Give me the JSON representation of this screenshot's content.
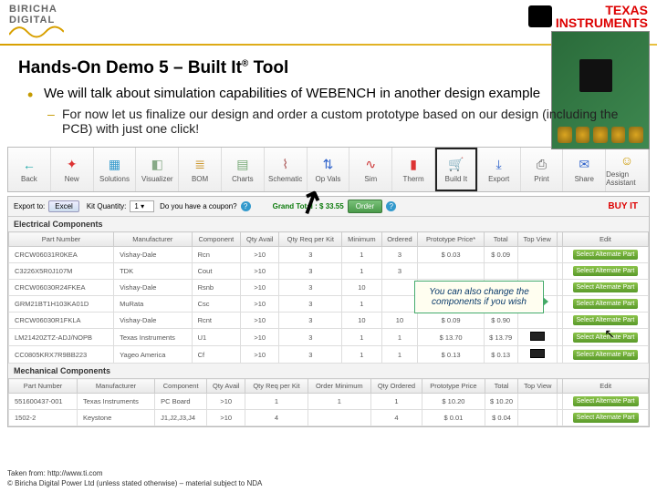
{
  "logos": {
    "biricha1": "BIRICHA",
    "biricha2": "DIGITAL",
    "ti1": "TEXAS",
    "ti2": "INSTRUMENTS"
  },
  "title_pre": "Hands-On Demo 5 – Built It",
  "title_post": " Tool",
  "reg": "®",
  "bullet1": "We will talk about simulation capabilities of WEBENCH in another design example",
  "bullet2": "For now let us finalize our design and order a custom prototype based on our design (including the PCB) with just one click!",
  "toolbar": [
    {
      "label": "Back",
      "glyph": "←",
      "c": "#2aa"
    },
    {
      "label": "New",
      "glyph": "✦",
      "c": "#d33"
    },
    {
      "label": "Solutions",
      "glyph": "▦",
      "c": "#39c"
    },
    {
      "label": "Visualizer",
      "glyph": "◧",
      "c": "#8a8"
    },
    {
      "label": "BOM",
      "glyph": "≣",
      "c": "#c93"
    },
    {
      "label": "Charts",
      "glyph": "▤",
      "c": "#7a7"
    },
    {
      "label": "Schematic",
      "glyph": "⌇",
      "c": "#a55"
    },
    {
      "label": "Op Vals",
      "glyph": "⇅",
      "c": "#36c"
    },
    {
      "label": "Sim",
      "glyph": "∿",
      "c": "#c33"
    },
    {
      "label": "Therm",
      "glyph": "▮",
      "c": "#d33"
    },
    {
      "label": "Build It",
      "glyph": "🛒",
      "c": "#3a3",
      "hl": true
    },
    {
      "label": "Export",
      "glyph": "⤓",
      "c": "#36c"
    },
    {
      "label": "Print",
      "glyph": "⎙",
      "c": "#555"
    },
    {
      "label": "Share",
      "glyph": "✉",
      "c": "#36c"
    },
    {
      "label": "Design Assistant",
      "glyph": "☺",
      "c": "#c90"
    }
  ],
  "panel": {
    "export_to": "Export to:",
    "excel": "Excel",
    "kit_qty_lbl": "Kit Quantity:",
    "kit_qty_val": "1 ▾",
    "coupon": "Do you have a coupon?",
    "grand_lbl": "Grand Total :",
    "grand_val": "$ 33.55",
    "order": "Order",
    "buy": "BUY IT"
  },
  "sect_elec": "Electrical Components",
  "elec_headers": [
    "Part Number",
    "Manufacturer",
    "Component",
    "Qty Avail",
    "Qty Req per Kit",
    "Minimum",
    "Ordered",
    "Prototype Price*",
    "Total",
    "Top View",
    "",
    "Edit"
  ],
  "elec_rows": [
    [
      "CRCW06031R0KEA",
      "Vishay-Dale",
      "Rcn",
      ">10",
      "3",
      "1",
      "3",
      "$ 0.03",
      "$ 0.09",
      "",
      ""
    ],
    [
      "C3226X5R0J107M",
      "TDK",
      "Cout",
      ">10",
      "3",
      "1",
      "3",
      "",
      "",
      "",
      ""
    ],
    [
      "CRCW06030R24FKEA",
      "Vishay-Dale",
      "Rsnb",
      ">10",
      "3",
      "10",
      "",
      "",
      "",
      "",
      ""
    ],
    [
      "GRM21BT1H103KA01D",
      "MuRata",
      "Csc",
      ">10",
      "3",
      "1",
      "",
      "",
      "",
      "",
      ""
    ],
    [
      "CRCW06030R1FKLA",
      "Vishay-Dale",
      "Rcnt",
      ">10",
      "3",
      "10",
      "10",
      "$ 0.09",
      "$ 0.90",
      "",
      ""
    ],
    [
      "LM21420ZTZ-ADJ/NOPB",
      "Texas Instruments",
      "U1",
      ">10",
      "3",
      "1",
      "1",
      "$ 13.70",
      "$ 13.79",
      "chip",
      ""
    ],
    [
      "CC0805KRX7R9BB223",
      "Yageo America",
      "Cf",
      ">10",
      "3",
      "1",
      "1",
      "$ 0.13",
      "$ 0.13",
      "chip",
      ""
    ]
  ],
  "sect_mech": "Mechanical Components",
  "mech_headers": [
    "Part Number",
    "Manufacturer",
    "Component",
    "Qty Avail",
    "Qty Req per Kit",
    "Order Minimum",
    "Qty Ordered",
    "Prototype Price",
    "Total",
    "Top View",
    "",
    "Edit"
  ],
  "mech_rows": [
    [
      "551600437-001",
      "Texas Instruments",
      "PC Board",
      ">10",
      "1",
      "1",
      "1",
      "$ 10.20",
      "$ 10.20",
      "",
      ""
    ],
    [
      "1502-2",
      "Keystone",
      "J1,J2,J3,J4",
      ">10",
      "4",
      "",
      "4",
      "$ 0.01",
      "$ 0.04",
      "",
      ""
    ]
  ],
  "edit_elec": "Select Alternate Part",
  "edit_mech": "Select Alternate Part",
  "callout": "You can also change the components if you wish",
  "footer1": "Taken from: http://www.ti.com",
  "footer2": "© Biricha Digital Power Ltd  (unless stated otherwise) – material subject to NDA"
}
